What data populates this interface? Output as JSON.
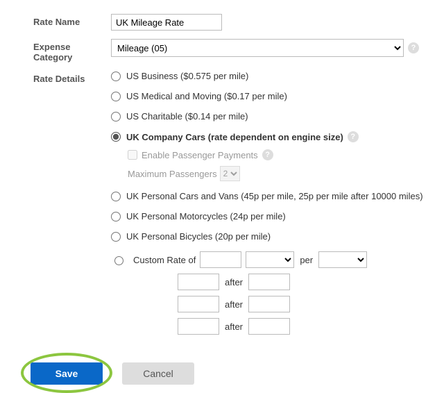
{
  "labels": {
    "rate_name": "Rate Name",
    "expense_category": "Expense Category",
    "rate_details": "Rate Details"
  },
  "rate_name_value": "UK Mileage Rate",
  "category_selected": "Mileage (05)",
  "options": {
    "us_business": "US Business ($0.575 per mile)",
    "us_medical": "US Medical and Moving ($0.17 per mile)",
    "us_charitable": "US Charitable ($0.14 per mile)",
    "uk_company": "UK Company Cars (rate dependent on engine size)",
    "uk_personal_cars": "UK Personal Cars and Vans (45p per mile, 25p per mile after 10000 miles)",
    "uk_motorcycles": "UK Personal Motorcycles (24p per mile)",
    "uk_bicycles": "UK Personal Bicycles (20p per mile)",
    "custom_rate": "Custom Rate of"
  },
  "sub": {
    "enable_passenger": "Enable Passenger Payments",
    "max_passengers_label": "Maximum Passengers",
    "max_passengers_value": "2"
  },
  "custom": {
    "per": "per",
    "after": "after"
  },
  "buttons": {
    "save": "Save",
    "cancel": "Cancel"
  }
}
